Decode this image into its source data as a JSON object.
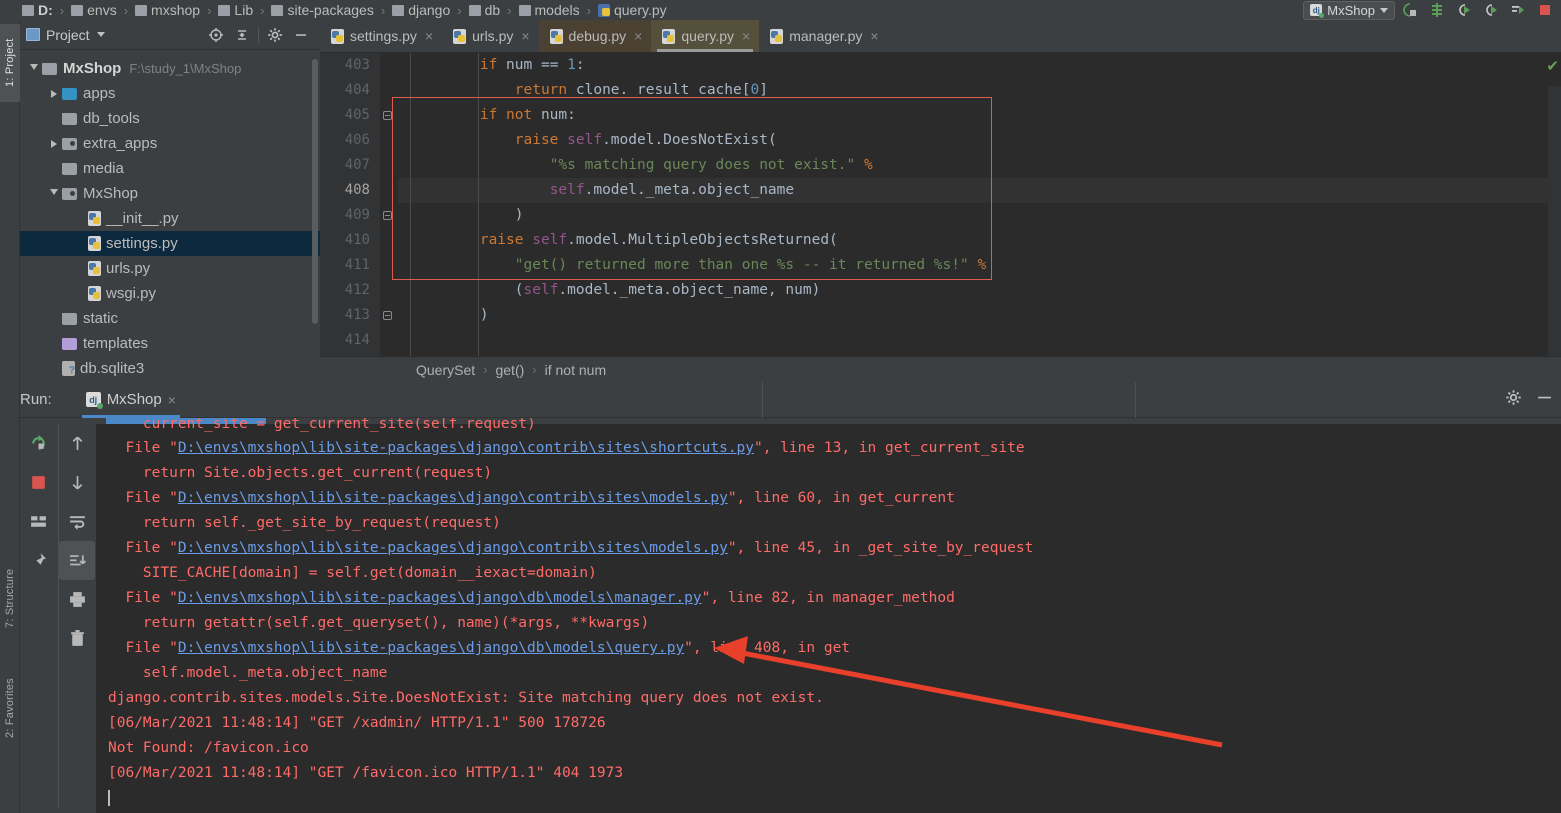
{
  "navbar": {
    "crumbs": [
      {
        "label": "D:",
        "icon": "folder-icon",
        "bold": true
      },
      {
        "label": "envs",
        "icon": "folder-icon",
        "bold": false
      },
      {
        "label": "mxshop",
        "icon": "folder-icon",
        "bold": false
      },
      {
        "label": "Lib",
        "icon": "folder-icon",
        "bold": false
      },
      {
        "label": "site-packages",
        "icon": "folder-icon",
        "bold": false
      },
      {
        "label": "django",
        "icon": "folder-icon",
        "bold": false
      },
      {
        "label": "db",
        "icon": "folder-icon",
        "bold": false
      },
      {
        "label": "models",
        "icon": "folder-icon",
        "bold": false
      },
      {
        "label": "query.py",
        "icon": "python-file-icon",
        "bold": false
      }
    ],
    "separator": "›",
    "run_config": "MxShop",
    "toolbar_icons": [
      "run-with-coverage-icon",
      "profile-icon",
      "debug-icon",
      "rerun-icon",
      "step-icon",
      "stop-icon"
    ]
  },
  "left_strip": {
    "labels": [
      "1: Project",
      "7: Structure",
      "2: Favorites"
    ]
  },
  "project_panel": {
    "title": "Project",
    "header_icons": [
      "locate-icon",
      "collapse-all-icon",
      "gear-icon",
      "hide-icon"
    ],
    "tree": [
      {
        "label": "MxShop",
        "path": "F:\\study_1\\MxShop",
        "icon": "folder-icon",
        "indent": 0,
        "arrow": "open",
        "bold": true,
        "selected": false
      },
      {
        "label": "apps",
        "path": "",
        "icon": "folder-blue-icon",
        "indent": 1,
        "arrow": "closed",
        "bold": false,
        "selected": false
      },
      {
        "label": "db_tools",
        "path": "",
        "icon": "folder-icon",
        "indent": 1,
        "arrow": "none",
        "bold": false,
        "selected": false
      },
      {
        "label": "extra_apps",
        "path": "",
        "icon": "folder-module-icon",
        "indent": 1,
        "arrow": "closed",
        "bold": false,
        "selected": false
      },
      {
        "label": "media",
        "path": "",
        "icon": "folder-icon",
        "indent": 1,
        "arrow": "none",
        "bold": false,
        "selected": false
      },
      {
        "label": "MxShop",
        "path": "",
        "icon": "folder-module-icon",
        "indent": 1,
        "arrow": "open",
        "bold": false,
        "selected": false
      },
      {
        "label": "__init__.py",
        "path": "",
        "icon": "python-file-icon",
        "indent": 2,
        "arrow": "none",
        "bold": false,
        "selected": false
      },
      {
        "label": "settings.py",
        "path": "",
        "icon": "python-file-icon",
        "indent": 2,
        "arrow": "none",
        "bold": false,
        "selected": true
      },
      {
        "label": "urls.py",
        "path": "",
        "icon": "python-file-icon",
        "indent": 2,
        "arrow": "none",
        "bold": false,
        "selected": false
      },
      {
        "label": "wsgi.py",
        "path": "",
        "icon": "python-file-icon",
        "indent": 2,
        "arrow": "none",
        "bold": false,
        "selected": false
      },
      {
        "label": "static",
        "path": "",
        "icon": "folder-icon",
        "indent": 1,
        "arrow": "none",
        "bold": false,
        "selected": false
      },
      {
        "label": "templates",
        "path": "",
        "icon": "folder-purple-icon",
        "indent": 1,
        "arrow": "none",
        "bold": false,
        "selected": false
      },
      {
        "label": "db.sqlite3",
        "path": "",
        "icon": "db-file-icon",
        "indent": 1,
        "arrow": "none",
        "bold": false,
        "selected": false
      }
    ]
  },
  "editor": {
    "tabs": [
      {
        "label": "settings.py",
        "state": "normal"
      },
      {
        "label": "urls.py",
        "state": "normal"
      },
      {
        "label": "debug.py",
        "state": "modified"
      },
      {
        "label": "query.py",
        "state": "active"
      },
      {
        "label": "manager.py",
        "state": "normal"
      }
    ],
    "close_glyph": "×",
    "first_line": 403,
    "current_line": 408,
    "lines": [
      {
        "num": "403",
        "tokens": [
          {
            "t": "        ",
            "c": "d"
          },
          {
            "t": "if ",
            "c": "k"
          },
          {
            "t": "num == ",
            "c": "d"
          },
          {
            "t": "1",
            "c": "n"
          },
          {
            "t": ":",
            "c": "d"
          }
        ]
      },
      {
        "num": "404",
        "tokens": [
          {
            "t": "            ",
            "c": "d"
          },
          {
            "t": "return ",
            "c": "k"
          },
          {
            "t": "clone._result_cache[",
            "c": "d"
          },
          {
            "t": "0",
            "c": "n"
          },
          {
            "t": "]",
            "c": "d"
          }
        ]
      },
      {
        "num": "405",
        "tokens": [
          {
            "t": "        ",
            "c": "d"
          },
          {
            "t": "if not ",
            "c": "k"
          },
          {
            "t": "num:",
            "c": "d"
          }
        ]
      },
      {
        "num": "406",
        "tokens": [
          {
            "t": "            ",
            "c": "d"
          },
          {
            "t": "raise ",
            "c": "k"
          },
          {
            "t": "self",
            "c": "self"
          },
          {
            "t": ".model.DoesNotExist(",
            "c": "d"
          }
        ]
      },
      {
        "num": "407",
        "tokens": [
          {
            "t": "                ",
            "c": "d"
          },
          {
            "t": "\"%s matching query does not exist.\" ",
            "c": "s"
          },
          {
            "t": "%",
            "c": "k"
          }
        ]
      },
      {
        "num": "408",
        "tokens": [
          {
            "t": "                ",
            "c": "d"
          },
          {
            "t": "self",
            "c": "self"
          },
          {
            "t": ".model._meta.object_name",
            "c": "d"
          }
        ]
      },
      {
        "num": "409",
        "tokens": [
          {
            "t": "            )",
            "c": "d"
          }
        ]
      },
      {
        "num": "410",
        "tokens": [
          {
            "t": "        ",
            "c": "d"
          },
          {
            "t": "raise ",
            "c": "k"
          },
          {
            "t": "self",
            "c": "self"
          },
          {
            "t": ".model.MultipleObjectsReturned(",
            "c": "d"
          }
        ]
      },
      {
        "num": "411",
        "tokens": [
          {
            "t": "            ",
            "c": "d"
          },
          {
            "t": "\"get() returned more than one %s -- it returned %s!\" ",
            "c": "s"
          },
          {
            "t": "%",
            "c": "k"
          }
        ]
      },
      {
        "num": "412",
        "tokens": [
          {
            "t": "            (",
            "c": "d"
          },
          {
            "t": "self",
            "c": "self"
          },
          {
            "t": ".model._meta.object_name, num)",
            "c": "d"
          }
        ]
      },
      {
        "num": "413",
        "tokens": [
          {
            "t": "        )",
            "c": "d"
          }
        ]
      },
      {
        "num": "414",
        "tokens": [
          {
            "t": "",
            "c": "d"
          }
        ]
      }
    ],
    "breadcrumb": [
      "QuerySet",
      "get()",
      "if not num"
    ],
    "breadcrumb_sep": "›",
    "inspection_status": "✔",
    "error_box_color": "#e05a4f"
  },
  "run_panel": {
    "label": "Run:",
    "tab_label": "MxShop",
    "tab_close": "×",
    "left_tool_icons": [
      "rerun-icon",
      "scroll-up-icon",
      "stop-icon",
      "scroll-down-icon",
      "layout-icon",
      "soft-wrap-icon",
      "pin-icon",
      "scroll-to-end-icon",
      "print-icon",
      "clear-all-icon"
    ],
    "right_icons": [
      "gear-icon",
      "hide-icon"
    ],
    "console_lines": [
      {
        "segments": [
          {
            "t": "    current_site = get_current_site(self.request)",
            "k": "txt"
          }
        ]
      },
      {
        "segments": [
          {
            "t": "  File \"",
            "k": "txt"
          },
          {
            "t": "D:\\envs\\mxshop\\lib\\site-packages\\django\\contrib\\sites\\shortcuts.py",
            "k": "link"
          },
          {
            "t": "\", line 13, in get_current_site",
            "k": "txt"
          }
        ]
      },
      {
        "segments": [
          {
            "t": "    return Site.objects.get_current(request)",
            "k": "txt"
          }
        ]
      },
      {
        "segments": [
          {
            "t": "  File \"",
            "k": "txt"
          },
          {
            "t": "D:\\envs\\mxshop\\lib\\site-packages\\django\\contrib\\sites\\models.py",
            "k": "link"
          },
          {
            "t": "\", line 60, in get_current",
            "k": "txt"
          }
        ]
      },
      {
        "segments": [
          {
            "t": "    return self._get_site_by_request(request)",
            "k": "txt"
          }
        ]
      },
      {
        "segments": [
          {
            "t": "  File \"",
            "k": "txt"
          },
          {
            "t": "D:\\envs\\mxshop\\lib\\site-packages\\django\\contrib\\sites\\models.py",
            "k": "link"
          },
          {
            "t": "\", line 45, in _get_site_by_request",
            "k": "txt"
          }
        ]
      },
      {
        "segments": [
          {
            "t": "    SITE_CACHE[domain] = self.get(domain__iexact=domain)",
            "k": "txt"
          }
        ]
      },
      {
        "segments": [
          {
            "t": "  File \"",
            "k": "txt"
          },
          {
            "t": "D:\\envs\\mxshop\\lib\\site-packages\\django\\db\\models\\manager.py",
            "k": "link"
          },
          {
            "t": "\", line 82, in manager_method",
            "k": "txt"
          }
        ]
      },
      {
        "segments": [
          {
            "t": "    return getattr(self.get_queryset(), name)(*args, **kwargs)",
            "k": "txt"
          }
        ]
      },
      {
        "segments": [
          {
            "t": "  File \"",
            "k": "txt"
          },
          {
            "t": "D:\\envs\\mxshop\\lib\\site-packages\\django\\db\\models\\query.py",
            "k": "link"
          },
          {
            "t": "\", line 408, in get",
            "k": "txt"
          }
        ]
      },
      {
        "segments": [
          {
            "t": "    self.model._meta.object_name",
            "k": "txt"
          }
        ]
      },
      {
        "segments": [
          {
            "t": "django.contrib.sites.models.Site.DoesNotExist: Site matching query does not exist.",
            "k": "txt"
          }
        ]
      },
      {
        "segments": [
          {
            "t": "[06/Mar/2021 11:48:14] \"GET /xadmin/ HTTP/1.1\" 500 178726",
            "k": "txt"
          }
        ]
      },
      {
        "segments": [
          {
            "t": "Not Found: /favicon.ico",
            "k": "txt"
          }
        ]
      },
      {
        "segments": [
          {
            "t": "[06/Mar/2021 11:48:14] \"GET /favicon.ico HTTP/1.1\" 404 1973",
            "k": "txt"
          }
        ]
      }
    ]
  },
  "colors": {
    "background": "#3c3f41",
    "editor_bg": "#2b2b2b",
    "accent_blue": "#4a88c7",
    "error_red": "#ff6b68",
    "annotation_red": "#e8402a",
    "link_blue": "#6a9ce8",
    "selection_blue": "#0d293e"
  }
}
